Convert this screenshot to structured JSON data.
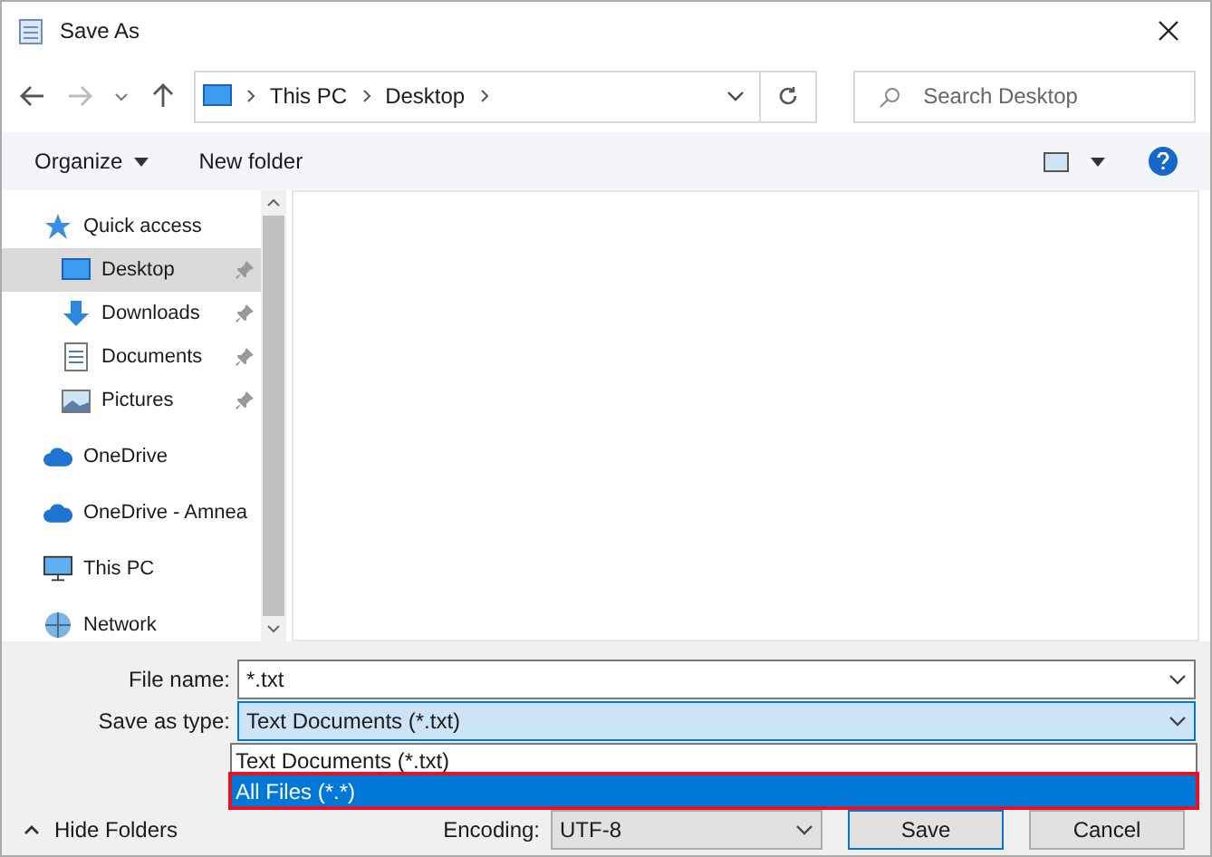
{
  "window": {
    "title": "Save As"
  },
  "address": {
    "crumbs": [
      "This PC",
      "Desktop"
    ],
    "search_placeholder": "Search Desktop"
  },
  "toolbar": {
    "organize": "Organize",
    "new_folder": "New folder"
  },
  "sidebar": {
    "items": [
      {
        "label": "Quick access",
        "kind": "star",
        "selected": false,
        "children": [
          {
            "label": "Desktop",
            "kind": "desktop",
            "selected": true
          },
          {
            "label": "Downloads",
            "kind": "download",
            "selected": false
          },
          {
            "label": "Documents",
            "kind": "document",
            "selected": false
          },
          {
            "label": "Pictures",
            "kind": "picture",
            "selected": false
          }
        ]
      },
      {
        "label": "OneDrive",
        "kind": "cloud",
        "selected": false
      },
      {
        "label": "OneDrive - Amnea",
        "kind": "cloud",
        "selected": false
      },
      {
        "label": "This PC",
        "kind": "pc",
        "selected": false
      },
      {
        "label": "Network",
        "kind": "network",
        "selected": false
      }
    ]
  },
  "form": {
    "file_name_label": "File name:",
    "file_name": "*.txt",
    "type_label": "Save as type:",
    "type_value": "Text Documents (*.txt)",
    "type_options": [
      {
        "label": "Text Documents (*.txt)",
        "selected": false
      },
      {
        "label": "All Files  (*.*)",
        "selected": true
      }
    ],
    "encoding_label": "Encoding:",
    "encoding_value": "UTF-8"
  },
  "footer": {
    "hide_folders": "Hide Folders",
    "save": "Save",
    "cancel": "Cancel"
  }
}
